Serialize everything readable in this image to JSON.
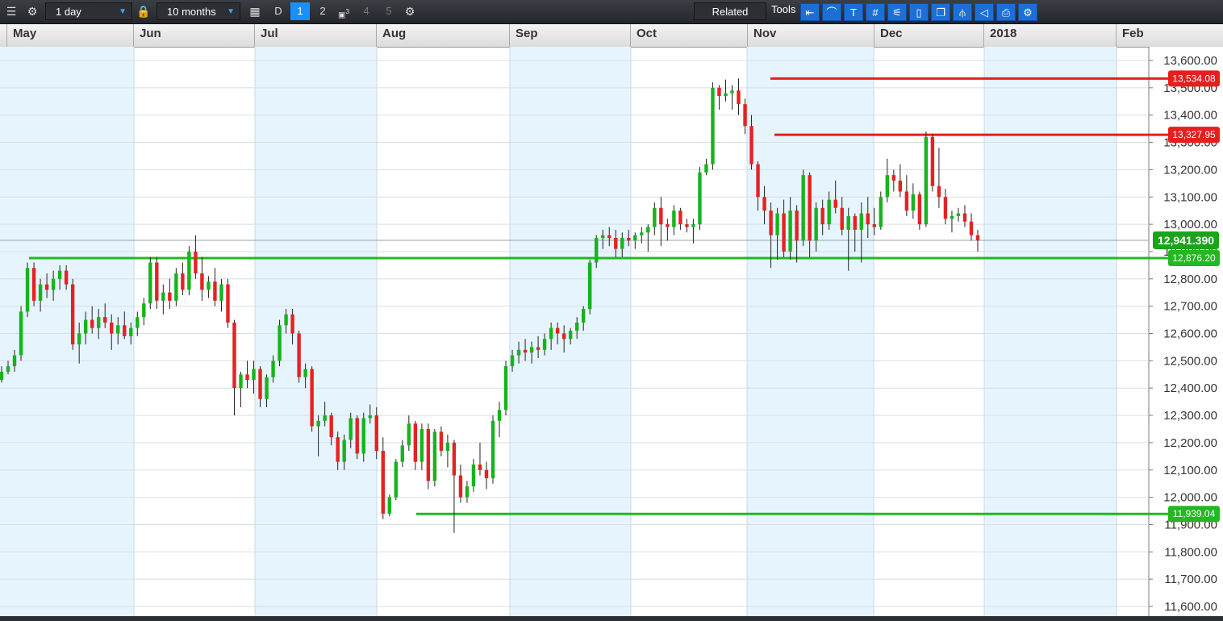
{
  "toolbar": {
    "interval": "1 day",
    "range": "10 months",
    "period_d": "D",
    "layouts": [
      "1",
      "2",
      "3",
      "4",
      "5"
    ],
    "related": "Related",
    "tools": "Tools"
  },
  "chart_data": {
    "type": "candlestick",
    "title": "",
    "x_axis_labels": [
      "May",
      "Jun",
      "Jul",
      "Aug",
      "Sep",
      "Oct",
      "Nov",
      "Dec",
      "2018",
      "Feb"
    ],
    "y_axis_ticks": [
      11600,
      11700,
      11800,
      11900,
      12000,
      12100,
      12200,
      12300,
      12400,
      12500,
      12600,
      12700,
      12800,
      12900,
      13000,
      13100,
      13200,
      13300,
      13400,
      13500,
      13600
    ],
    "y_tick_labels": [
      "11,600.00",
      "11,700.00",
      "11,800.00",
      "11,900.00",
      "12,000.00",
      "12,100.00",
      "12,200.00",
      "12,300.00",
      "12,400.00",
      "12,500.00",
      "12,600.00",
      "12,700.00",
      "12,800.00",
      "12,900.00",
      "13,000.00",
      "13,100.00",
      "13,200.00",
      "13,300.00",
      "13,400.00",
      "13,500.00",
      "13,600.00"
    ],
    "ylim": [
      11580,
      13640
    ],
    "current_price": 12941.39,
    "current_price_label": "12,941.390",
    "colors": {
      "up": "#16b41c",
      "down": "#e52222",
      "shade": "#e6f4fd",
      "grid": "#d8dee6"
    },
    "horizontal_lines": [
      {
        "value": 13534.08,
        "label": "13,534.08",
        "color": "#e61e1e"
      },
      {
        "value": 13327.95,
        "label": "13,327.95",
        "color": "#e61e1e"
      },
      {
        "value": 12876.2,
        "label": "12,876.20",
        "color": "#22b822"
      },
      {
        "value": 11939.04,
        "label": "11,939.04",
        "color": "#22b822"
      }
    ],
    "candles": [
      [
        12430,
        12480,
        12420,
        12460
      ],
      [
        12460,
        12500,
        12450,
        12480
      ],
      [
        12480,
        12540,
        12460,
        12520
      ],
      [
        12520,
        12700,
        12500,
        12680
      ],
      [
        12680,
        12860,
        12660,
        12840
      ],
      [
        12840,
        12860,
        12700,
        12720
      ],
      [
        12720,
        12800,
        12680,
        12780
      ],
      [
        12780,
        12820,
        12730,
        12760
      ],
      [
        12760,
        12830,
        12720,
        12800
      ],
      [
        12800,
        12850,
        12760,
        12830
      ],
      [
        12830,
        12850,
        12760,
        12780
      ],
      [
        12780,
        12800,
        12540,
        12560
      ],
      [
        12560,
        12640,
        12490,
        12600
      ],
      [
        12600,
        12680,
        12560,
        12650
      ],
      [
        12650,
        12700,
        12600,
        12620
      ],
      [
        12620,
        12690,
        12580,
        12660
      ],
      [
        12660,
        12710,
        12620,
        12640
      ],
      [
        12640,
        12670,
        12540,
        12600
      ],
      [
        12600,
        12660,
        12560,
        12630
      ],
      [
        12630,
        12680,
        12580,
        12590
      ],
      [
        12590,
        12640,
        12560,
        12620
      ],
      [
        12620,
        12680,
        12590,
        12660
      ],
      [
        12660,
        12730,
        12630,
        12710
      ],
      [
        12710,
        12880,
        12690,
        12860
      ],
      [
        12860,
        12880,
        12690,
        12720
      ],
      [
        12720,
        12780,
        12670,
        12750
      ],
      [
        12750,
        12800,
        12690,
        12720
      ],
      [
        12720,
        12840,
        12700,
        12820
      ],
      [
        12820,
        12860,
        12740,
        12760
      ],
      [
        12760,
        12920,
        12740,
        12900
      ],
      [
        12900,
        12960,
        12800,
        12820
      ],
      [
        12820,
        12880,
        12720,
        12760
      ],
      [
        12760,
        12810,
        12730,
        12790
      ],
      [
        12790,
        12840,
        12700,
        12720
      ],
      [
        12720,
        12800,
        12680,
        12780
      ],
      [
        12780,
        12800,
        12620,
        12640
      ],
      [
        12640,
        12650,
        12300,
        12400
      ],
      [
        12400,
        12460,
        12330,
        12450
      ],
      [
        12450,
        12500,
        12400,
        12430
      ],
      [
        12430,
        12500,
        12380,
        12470
      ],
      [
        12470,
        12480,
        12330,
        12360
      ],
      [
        12360,
        12450,
        12330,
        12440
      ],
      [
        12440,
        12520,
        12420,
        12500
      ],
      [
        12500,
        12650,
        12480,
        12630
      ],
      [
        12630,
        12690,
        12600,
        12670
      ],
      [
        12670,
        12690,
        12560,
        12600
      ],
      [
        12600,
        12610,
        12420,
        12440
      ],
      [
        12440,
        12490,
        12400,
        12470
      ],
      [
        12470,
        12480,
        12240,
        12260
      ],
      [
        12260,
        12300,
        12150,
        12280
      ],
      [
        12280,
        12350,
        12260,
        12300
      ],
      [
        12300,
        12310,
        12190,
        12220
      ],
      [
        12220,
        12240,
        12100,
        12130
      ],
      [
        12130,
        12230,
        12100,
        12210
      ],
      [
        12210,
        12310,
        12180,
        12290
      ],
      [
        12290,
        12300,
        12140,
        12160
      ],
      [
        12160,
        12310,
        12130,
        12290
      ],
      [
        12290,
        12340,
        12270,
        12300
      ],
      [
        12300,
        12330,
        12140,
        12170
      ],
      [
        12170,
        12220,
        11920,
        11940
      ],
      [
        11940,
        12010,
        11930,
        12000
      ],
      [
        12000,
        12140,
        11990,
        12130
      ],
      [
        12130,
        12210,
        12110,
        12190
      ],
      [
        12190,
        12300,
        12170,
        12270
      ],
      [
        12270,
        12280,
        12100,
        12130
      ],
      [
        12130,
        12270,
        12100,
        12250
      ],
      [
        12250,
        12270,
        12030,
        12060
      ],
      [
        12060,
        12250,
        12040,
        12240
      ],
      [
        12240,
        12260,
        12150,
        12170
      ],
      [
        12170,
        12230,
        12110,
        12200
      ],
      [
        12200,
        12210,
        11870,
        12080
      ],
      [
        12080,
        12120,
        11980,
        12000
      ],
      [
        12000,
        12060,
        11980,
        12040
      ],
      [
        12040,
        12140,
        12020,
        12120
      ],
      [
        12120,
        12200,
        12080,
        12100
      ],
      [
        12100,
        12130,
        12030,
        12070
      ],
      [
        12070,
        12300,
        12050,
        12280
      ],
      [
        12280,
        12350,
        12220,
        12320
      ],
      [
        12320,
        12500,
        12300,
        12480
      ],
      [
        12480,
        12540,
        12460,
        12520
      ],
      [
        12520,
        12570,
        12490,
        12540
      ],
      [
        12540,
        12580,
        12500,
        12530
      ],
      [
        12530,
        12570,
        12490,
        12550
      ],
      [
        12550,
        12590,
        12510,
        12540
      ],
      [
        12540,
        12600,
        12520,
        12580
      ],
      [
        12580,
        12640,
        12540,
        12620
      ],
      [
        12620,
        12640,
        12560,
        12600
      ],
      [
        12600,
        12630,
        12530,
        12580
      ],
      [
        12580,
        12620,
        12560,
        12610
      ],
      [
        12610,
        12660,
        12580,
        12640
      ],
      [
        12640,
        12700,
        12610,
        12690
      ],
      [
        12690,
        12870,
        12670,
        12860
      ],
      [
        12860,
        12960,
        12840,
        12950
      ],
      [
        12950,
        12980,
        12910,
        12960
      ],
      [
        12960,
        12990,
        12920,
        12950
      ],
      [
        12950,
        12980,
        12880,
        12910
      ],
      [
        12910,
        12970,
        12880,
        12950
      ],
      [
        12950,
        12980,
        12920,
        12940
      ],
      [
        12940,
        12970,
        12910,
        12960
      ],
      [
        12960,
        12990,
        12930,
        12970
      ],
      [
        12970,
        13000,
        12900,
        12990
      ],
      [
        12990,
        13080,
        12960,
        13060
      ],
      [
        13060,
        13100,
        12920,
        13000
      ],
      [
        13000,
        13020,
        12940,
        12990
      ],
      [
        12990,
        13070,
        12960,
        13050
      ],
      [
        13050,
        13060,
        12980,
        13000
      ],
      [
        13000,
        13020,
        12970,
        12990
      ],
      [
        12990,
        13020,
        12930,
        13000
      ],
      [
        13000,
        13210,
        12980,
        13190
      ],
      [
        13190,
        13240,
        13180,
        13220
      ],
      [
        13220,
        13520,
        13200,
        13500
      ],
      [
        13500,
        13510,
        13420,
        13470
      ],
      [
        13470,
        13530,
        13450,
        13480
      ],
      [
        13480,
        13510,
        13420,
        13490
      ],
      [
        13490,
        13534,
        13400,
        13440
      ],
      [
        13440,
        13460,
        13330,
        13360
      ],
      [
        13360,
        13400,
        13200,
        13220
      ],
      [
        13220,
        13230,
        13050,
        13100
      ],
      [
        13100,
        13140,
        13000,
        13050
      ],
      [
        13050,
        13080,
        12840,
        12960
      ],
      [
        12960,
        13060,
        12870,
        13040
      ],
      [
        13040,
        13090,
        12880,
        12900
      ],
      [
        12900,
        13100,
        12870,
        13050
      ],
      [
        13050,
        13070,
        12860,
        12940
      ],
      [
        12940,
        13200,
        12920,
        13180
      ],
      [
        13180,
        13190,
        12880,
        12940
      ],
      [
        12940,
        13080,
        12900,
        13060
      ],
      [
        13060,
        13090,
        12960,
        13000
      ],
      [
        13000,
        13120,
        12980,
        13090
      ],
      [
        13090,
        13160,
        13040,
        13060
      ],
      [
        13060,
        13100,
        12960,
        12980
      ],
      [
        12980,
        13060,
        12830,
        13030
      ],
      [
        13030,
        13040,
        12900,
        12980
      ],
      [
        12980,
        13080,
        12860,
        13040
      ],
      [
        13040,
        13100,
        12950,
        13000
      ],
      [
        13000,
        13060,
        12960,
        12990
      ],
      [
        12990,
        13120,
        12980,
        13100
      ],
      [
        13100,
        13240,
        13080,
        13180
      ],
      [
        13180,
        13200,
        13120,
        13160
      ],
      [
        13160,
        13220,
        13100,
        13120
      ],
      [
        13120,
        13180,
        13030,
        13050
      ],
      [
        13050,
        13150,
        13020,
        13110
      ],
      [
        13110,
        13120,
        12980,
        13000
      ],
      [
        13000,
        13340,
        12990,
        13320
      ],
      [
        13320,
        13330,
        13120,
        13140
      ],
      [
        13140,
        13280,
        13060,
        13100
      ],
      [
        13100,
        13130,
        13000,
        13020
      ],
      [
        13020,
        13050,
        12970,
        13030
      ],
      [
        13030,
        13060,
        13010,
        13040
      ],
      [
        13040,
        13070,
        12990,
        13010
      ],
      [
        13010,
        13040,
        12940,
        12960
      ],
      [
        12960,
        12980,
        12900,
        12941
      ]
    ]
  }
}
